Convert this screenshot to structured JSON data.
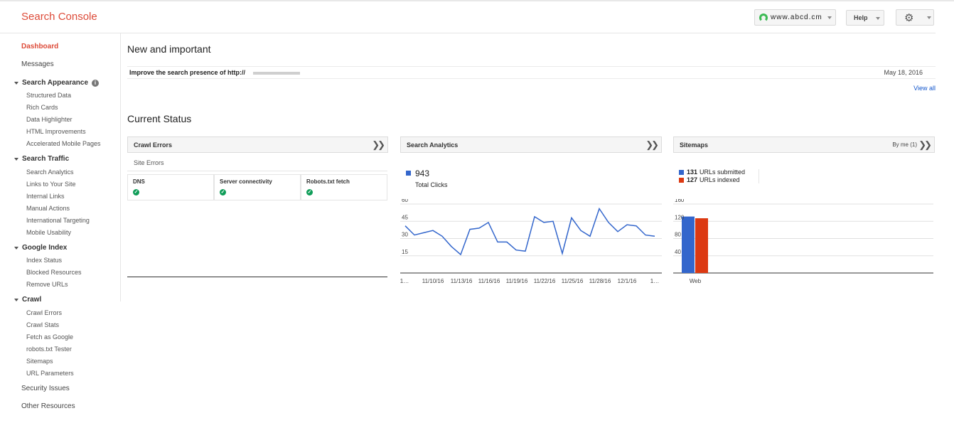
{
  "header": {
    "app_title": "Search Console",
    "site_selector": "www.abcd.cm",
    "help_label": "Help",
    "settings_icon": "gear-icon"
  },
  "sidebar": {
    "dashboard": "Dashboard",
    "messages": "Messages",
    "search_appearance": {
      "label": "Search Appearance",
      "items": [
        "Structured Data",
        "Rich Cards",
        "Data Highlighter",
        "HTML Improvements",
        "Accelerated Mobile Pages"
      ]
    },
    "search_traffic": {
      "label": "Search Traffic",
      "items": [
        "Search Analytics",
        "Links to Your Site",
        "Internal Links",
        "Manual Actions",
        "International Targeting",
        "Mobile Usability"
      ]
    },
    "google_index": {
      "label": "Google Index",
      "items": [
        "Index Status",
        "Blocked Resources",
        "Remove URLs"
      ]
    },
    "crawl": {
      "label": "Crawl",
      "items": [
        "Crawl Errors",
        "Crawl Stats",
        "Fetch as Google",
        "robots.txt Tester",
        "Sitemaps",
        "URL Parameters"
      ]
    },
    "security_issues": "Security Issues",
    "other_resources": "Other Resources"
  },
  "main": {
    "new_and_important": "New and important",
    "message": {
      "text": "Improve the search presence of http://",
      "date": "May 18, 2016"
    },
    "view_all": "View all",
    "current_status": "Current Status",
    "crawl_errors": {
      "title": "Crawl Errors",
      "site_errors": "Site Errors",
      "columns": [
        "DNS",
        "Server connectivity",
        "Robots.txt fetch"
      ]
    },
    "search_analytics": {
      "title": "Search Analytics",
      "total_clicks": "943",
      "total_clicks_label": "Total Clicks"
    },
    "sitemaps": {
      "title": "Sitemaps",
      "by_me": "By me (1)",
      "submitted_count": "131",
      "submitted_label": "URLs submitted",
      "indexed_count": "127",
      "indexed_label": "URLs indexed"
    }
  },
  "colors": {
    "brand_red": "#dd4b39",
    "link_blue": "#1155cc",
    "series_blue": "#3366cc",
    "series_red": "#dc3912",
    "check_green": "#0f9d58"
  },
  "chart_data": [
    {
      "type": "line",
      "title": "Search Analytics",
      "series": [
        {
          "name": "Total Clicks",
          "values": [
            41,
            33,
            35,
            37,
            32,
            23,
            16,
            38,
            39,
            44,
            27,
            27,
            20,
            19,
            49,
            44,
            45,
            17,
            48,
            37,
            32,
            56,
            44,
            36,
            42,
            41,
            33,
            32
          ]
        }
      ],
      "x_tick_labels": [
        "1…",
        "11/10/16",
        "11/13/16",
        "11/16/16",
        "11/19/16",
        "11/22/16",
        "11/25/16",
        "11/28/16",
        "12/1/16",
        "1…"
      ],
      "y_tick_labels": [
        "60",
        "45",
        "30",
        "15"
      ],
      "ylim": [
        0,
        60
      ]
    },
    {
      "type": "bar",
      "title": "Sitemaps",
      "categories": [
        "Web"
      ],
      "series": [
        {
          "name": "URLs submitted",
          "values": [
            131
          ]
        },
        {
          "name": "URLs indexed",
          "values": [
            127
          ]
        }
      ],
      "y_tick_labels": [
        "160",
        "120",
        "80",
        "40"
      ],
      "ylim": [
        0,
        160
      ]
    }
  ]
}
